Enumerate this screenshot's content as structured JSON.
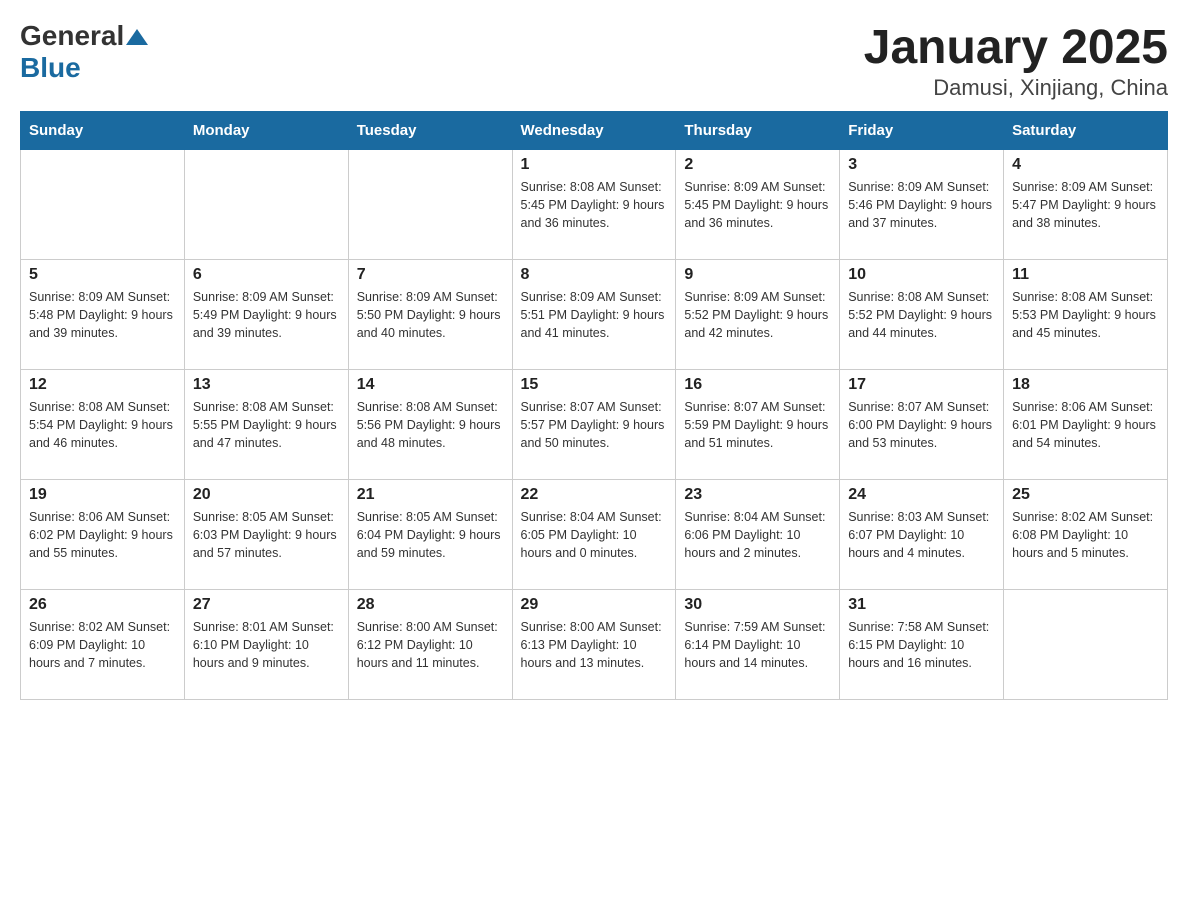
{
  "header": {
    "logo_general": "General",
    "logo_blue": "Blue",
    "title": "January 2025",
    "subtitle": "Damusi, Xinjiang, China"
  },
  "days_of_week": [
    "Sunday",
    "Monday",
    "Tuesday",
    "Wednesday",
    "Thursday",
    "Friday",
    "Saturday"
  ],
  "weeks": [
    [
      {
        "day": "",
        "info": ""
      },
      {
        "day": "",
        "info": ""
      },
      {
        "day": "",
        "info": ""
      },
      {
        "day": "1",
        "info": "Sunrise: 8:08 AM\nSunset: 5:45 PM\nDaylight: 9 hours and 36 minutes."
      },
      {
        "day": "2",
        "info": "Sunrise: 8:09 AM\nSunset: 5:45 PM\nDaylight: 9 hours and 36 minutes."
      },
      {
        "day": "3",
        "info": "Sunrise: 8:09 AM\nSunset: 5:46 PM\nDaylight: 9 hours and 37 minutes."
      },
      {
        "day": "4",
        "info": "Sunrise: 8:09 AM\nSunset: 5:47 PM\nDaylight: 9 hours and 38 minutes."
      }
    ],
    [
      {
        "day": "5",
        "info": "Sunrise: 8:09 AM\nSunset: 5:48 PM\nDaylight: 9 hours and 39 minutes."
      },
      {
        "day": "6",
        "info": "Sunrise: 8:09 AM\nSunset: 5:49 PM\nDaylight: 9 hours and 39 minutes."
      },
      {
        "day": "7",
        "info": "Sunrise: 8:09 AM\nSunset: 5:50 PM\nDaylight: 9 hours and 40 minutes."
      },
      {
        "day": "8",
        "info": "Sunrise: 8:09 AM\nSunset: 5:51 PM\nDaylight: 9 hours and 41 minutes."
      },
      {
        "day": "9",
        "info": "Sunrise: 8:09 AM\nSunset: 5:52 PM\nDaylight: 9 hours and 42 minutes."
      },
      {
        "day": "10",
        "info": "Sunrise: 8:08 AM\nSunset: 5:52 PM\nDaylight: 9 hours and 44 minutes."
      },
      {
        "day": "11",
        "info": "Sunrise: 8:08 AM\nSunset: 5:53 PM\nDaylight: 9 hours and 45 minutes."
      }
    ],
    [
      {
        "day": "12",
        "info": "Sunrise: 8:08 AM\nSunset: 5:54 PM\nDaylight: 9 hours and 46 minutes."
      },
      {
        "day": "13",
        "info": "Sunrise: 8:08 AM\nSunset: 5:55 PM\nDaylight: 9 hours and 47 minutes."
      },
      {
        "day": "14",
        "info": "Sunrise: 8:08 AM\nSunset: 5:56 PM\nDaylight: 9 hours and 48 minutes."
      },
      {
        "day": "15",
        "info": "Sunrise: 8:07 AM\nSunset: 5:57 PM\nDaylight: 9 hours and 50 minutes."
      },
      {
        "day": "16",
        "info": "Sunrise: 8:07 AM\nSunset: 5:59 PM\nDaylight: 9 hours and 51 minutes."
      },
      {
        "day": "17",
        "info": "Sunrise: 8:07 AM\nSunset: 6:00 PM\nDaylight: 9 hours and 53 minutes."
      },
      {
        "day": "18",
        "info": "Sunrise: 8:06 AM\nSunset: 6:01 PM\nDaylight: 9 hours and 54 minutes."
      }
    ],
    [
      {
        "day": "19",
        "info": "Sunrise: 8:06 AM\nSunset: 6:02 PM\nDaylight: 9 hours and 55 minutes."
      },
      {
        "day": "20",
        "info": "Sunrise: 8:05 AM\nSunset: 6:03 PM\nDaylight: 9 hours and 57 minutes."
      },
      {
        "day": "21",
        "info": "Sunrise: 8:05 AM\nSunset: 6:04 PM\nDaylight: 9 hours and 59 minutes."
      },
      {
        "day": "22",
        "info": "Sunrise: 8:04 AM\nSunset: 6:05 PM\nDaylight: 10 hours and 0 minutes."
      },
      {
        "day": "23",
        "info": "Sunrise: 8:04 AM\nSunset: 6:06 PM\nDaylight: 10 hours and 2 minutes."
      },
      {
        "day": "24",
        "info": "Sunrise: 8:03 AM\nSunset: 6:07 PM\nDaylight: 10 hours and 4 minutes."
      },
      {
        "day": "25",
        "info": "Sunrise: 8:02 AM\nSunset: 6:08 PM\nDaylight: 10 hours and 5 minutes."
      }
    ],
    [
      {
        "day": "26",
        "info": "Sunrise: 8:02 AM\nSunset: 6:09 PM\nDaylight: 10 hours and 7 minutes."
      },
      {
        "day": "27",
        "info": "Sunrise: 8:01 AM\nSunset: 6:10 PM\nDaylight: 10 hours and 9 minutes."
      },
      {
        "day": "28",
        "info": "Sunrise: 8:00 AM\nSunset: 6:12 PM\nDaylight: 10 hours and 11 minutes."
      },
      {
        "day": "29",
        "info": "Sunrise: 8:00 AM\nSunset: 6:13 PM\nDaylight: 10 hours and 13 minutes."
      },
      {
        "day": "30",
        "info": "Sunrise: 7:59 AM\nSunset: 6:14 PM\nDaylight: 10 hours and 14 minutes."
      },
      {
        "day": "31",
        "info": "Sunrise: 7:58 AM\nSunset: 6:15 PM\nDaylight: 10 hours and 16 minutes."
      },
      {
        "day": "",
        "info": ""
      }
    ]
  ]
}
